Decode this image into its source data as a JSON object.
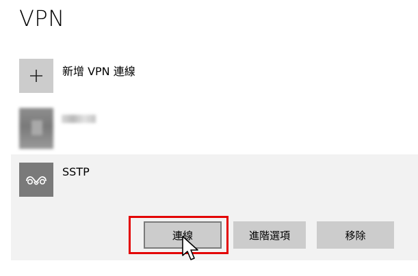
{
  "page": {
    "title": "VPN"
  },
  "add_vpn": {
    "label": "新增 VPN 連線",
    "icon": "plus-icon"
  },
  "connections": [
    {
      "name": "",
      "icon": "vpn-icon-blurred",
      "state": "collapsed"
    },
    {
      "name": "SSTP",
      "icon": "vpn-link-icon",
      "state": "expanded",
      "buttons": {
        "connect": "連線",
        "advanced": "進階選項",
        "remove": "移除"
      }
    }
  ],
  "colors": {
    "tile_gray": "#cccccc",
    "vpn_tile": "#7a7a7a",
    "panel_bg": "#f2f2f2",
    "highlight": "#e30000"
  }
}
